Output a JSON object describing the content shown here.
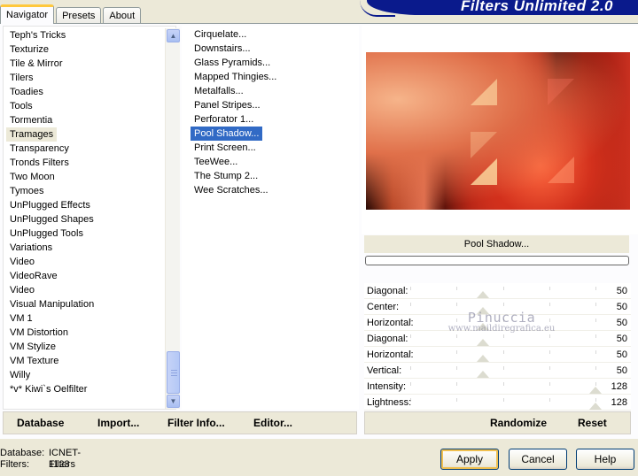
{
  "tabs": [
    {
      "label": "Navigator",
      "active": true
    },
    {
      "label": "Presets",
      "active": false
    },
    {
      "label": "About",
      "active": false
    }
  ],
  "banner": {
    "title": "Filters Unlimited 2.0"
  },
  "categories": {
    "items": [
      "Teph's Tricks",
      "Texturize",
      "Tile & Mirror",
      "Tilers",
      "Toadies",
      "Tools",
      "Tormentia",
      "Tramages",
      "Transparency",
      "Tronds Filters",
      "Two Moon",
      "Tymoes",
      "UnPlugged Effects",
      "UnPlugged Shapes",
      "UnPlugged Tools",
      "Variations",
      "Video",
      "VideoRave",
      "Video",
      "Visual Manipulation",
      "VM 1",
      "VM Distortion",
      "VM Stylize",
      "VM Texture",
      "Willy",
      "*v* Kiwi`s Oelfilter"
    ],
    "selected": "Tramages"
  },
  "filters": {
    "items": [
      "Cirquelate...",
      "Downstairs...",
      "Glass Pyramids...",
      "Mapped Thingies...",
      "Metalfalls...",
      "Panel Stripes...",
      "Perforator 1...",
      "Pool Shadow...",
      "Print Screen...",
      "TeeWee...",
      "The Stump 2...",
      "Wee Scratches..."
    ],
    "selected": "Pool Shadow..."
  },
  "preview": {
    "filter_name": "Pool Shadow...",
    "progress": 0
  },
  "params": [
    {
      "label": "Diagonal:",
      "value": "50",
      "fraction": 0.39
    },
    {
      "label": "Center:",
      "value": "50",
      "fraction": 0.39
    },
    {
      "label": "Horizontal:",
      "value": "50",
      "fraction": 0.39
    },
    {
      "label": "Diagonal:",
      "value": "50",
      "fraction": 0.39
    },
    {
      "label": "Horizontal:",
      "value": "50",
      "fraction": 0.39
    },
    {
      "label": "Vertical:",
      "value": "50",
      "fraction": 0.39
    },
    {
      "label": "Intensity:",
      "value": "128",
      "fraction": 1.0
    },
    {
      "label": "Lightness:",
      "value": "128",
      "fraction": 1.0
    }
  ],
  "watermark": {
    "line1": "Pinuccia",
    "line2": "www.maildiregrafica.eu"
  },
  "toolbar": {
    "database": "Database",
    "import": "Import...",
    "filter_info": "Filter Info...",
    "editor": "Editor...",
    "randomize": "Randomize",
    "reset": "Reset"
  },
  "status": {
    "database_label": "Database:",
    "database_value": "ICNET-Filters",
    "filters_label": "Filters:",
    "filters_value": "1123"
  },
  "buttons": {
    "apply": "Apply",
    "cancel": "Cancel",
    "help": "Help"
  }
}
